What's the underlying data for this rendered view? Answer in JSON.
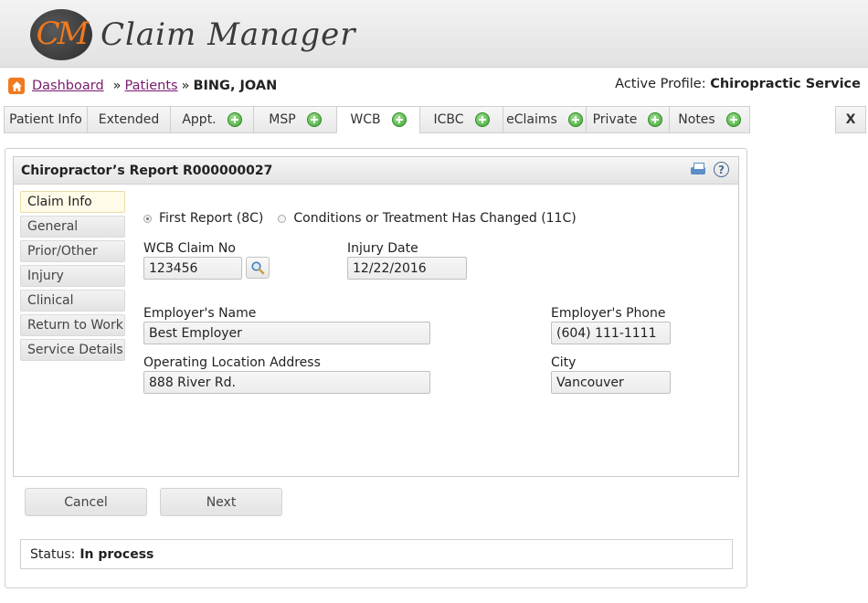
{
  "app": {
    "logo_initials": "CM",
    "logo_text": "Claim Manager"
  },
  "breadcrumb": {
    "dashboard": "Dashboard",
    "patients": "Patients",
    "sep": "»",
    "current": "BING, JOAN"
  },
  "profile": {
    "label": "Active Profile:",
    "value": "Chiropractic Service"
  },
  "tabs": [
    {
      "label": "Patient Info"
    },
    {
      "label": "Extended"
    },
    {
      "label": "Appt."
    },
    {
      "label": "MSP"
    },
    {
      "label": "WCB"
    },
    {
      "label": "ICBC"
    },
    {
      "label": "eClaims"
    },
    {
      "label": "Private"
    },
    {
      "label": "Notes"
    }
  ],
  "close_label": "X",
  "report": {
    "title": "Chiropractor’s Report R000000027"
  },
  "side_nav": [
    {
      "label": "Claim Info"
    },
    {
      "label": "General"
    },
    {
      "label": "Prior/Other"
    },
    {
      "label": "Injury"
    },
    {
      "label": "Clinical"
    },
    {
      "label": "Return to Work"
    },
    {
      "label": "Service Details"
    }
  ],
  "report_type": {
    "option1": "First Report (8C)",
    "option2": "Conditions or Treatment Has Changed (11C)",
    "selected": "First Report (8C)"
  },
  "form": {
    "wcb_claim_no_label": "WCB Claim No",
    "wcb_claim_no": "123456",
    "injury_date_label": "Injury Date",
    "injury_date": "12/22/2016",
    "employer_name_label": "Employer's Name",
    "employer_name": "Best Employer",
    "employer_phone_label": "Employer's Phone",
    "employer_phone": "(604) 111-1111",
    "operating_address_label": "Operating Location Address",
    "operating_address": "888 River Rd.",
    "city_label": "City",
    "city": "Vancouver"
  },
  "buttons": {
    "cancel": "Cancel",
    "next": "Next"
  },
  "status": {
    "label": "Status:",
    "value": "In process"
  },
  "colors": {
    "accent": "#f07a1f",
    "link": "#7a1a6e",
    "add_icon": "#3ea534"
  }
}
